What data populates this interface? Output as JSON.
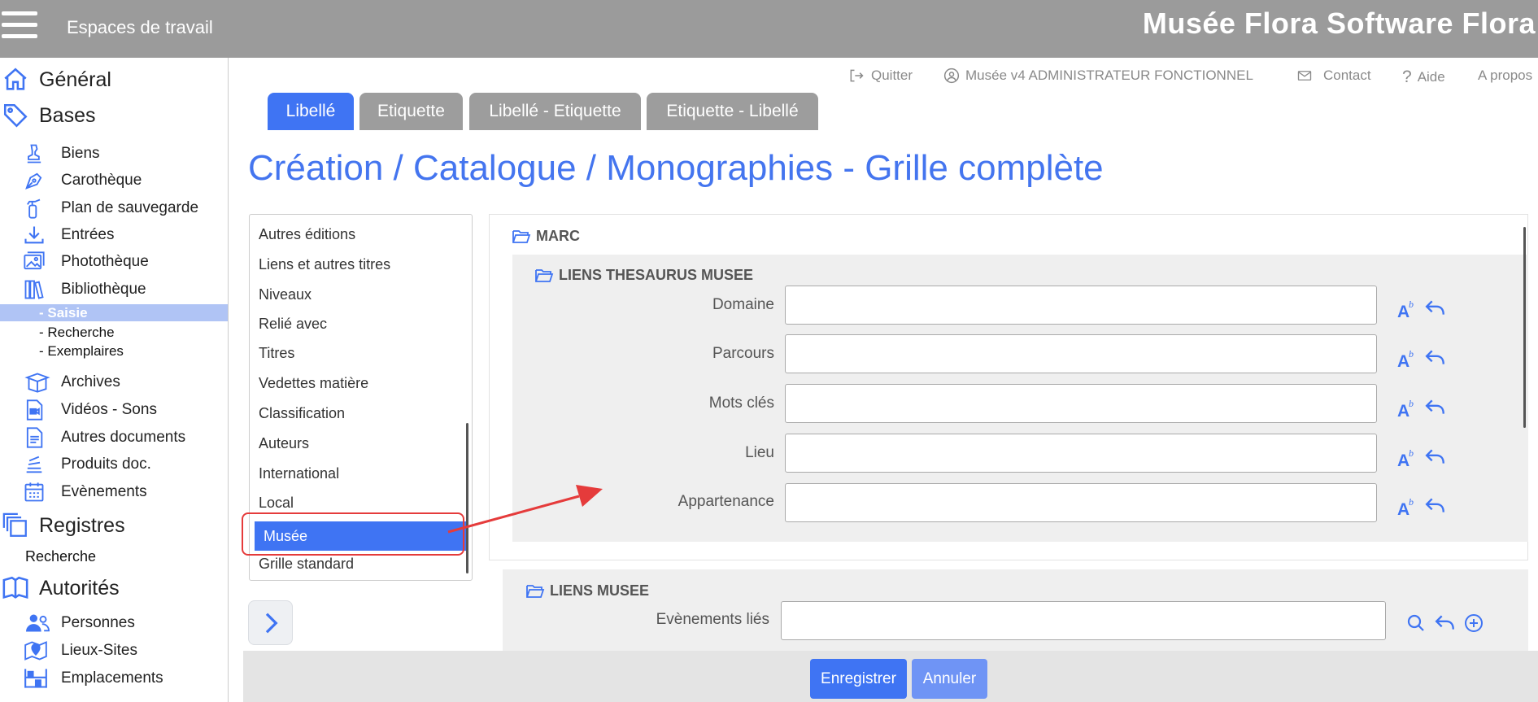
{
  "header": {
    "workspaces_label": "Espaces de travail",
    "brand": "Musée Flora Software Flora"
  },
  "sidebar": {
    "general": "Général",
    "bases": "Bases",
    "items": [
      {
        "label": "Biens",
        "icon": "bust-icon"
      },
      {
        "label": "Carothèque",
        "icon": "pen-nib-icon"
      },
      {
        "label": "Plan de sauvegarde",
        "icon": "fire-extinguisher-icon"
      },
      {
        "label": "Entrées",
        "icon": "download-icon"
      },
      {
        "label": "Photothèque",
        "icon": "images-icon"
      },
      {
        "label": "Bibliothèque",
        "icon": "books-icon"
      }
    ],
    "sub_items": [
      "- Saisie",
      "- Recherche",
      "- Exemplaires"
    ],
    "items2": [
      {
        "label": "Archives",
        "icon": "box-open-icon"
      },
      {
        "label": "Vidéos - Sons",
        "icon": "file-video-icon"
      },
      {
        "label": "Autres documents",
        "icon": "file-text-icon"
      },
      {
        "label": "Produits doc.",
        "icon": "stack-icon"
      },
      {
        "label": "Evènements",
        "icon": "calendar-icon"
      }
    ],
    "registres": "Registres",
    "recherche": "Recherche",
    "autorites": "Autorités",
    "items3": [
      {
        "label": "Personnes",
        "icon": "users-icon"
      },
      {
        "label": "Lieux-Sites",
        "icon": "map-marker-icon"
      },
      {
        "label": "Emplacements",
        "icon": "shelves-icon"
      }
    ]
  },
  "top_links": {
    "quit": "Quitter",
    "user": "Musée v4 ADMINISTRATEUR FONCTIONNEL",
    "contact": "Contact",
    "help": "Aide",
    "about": "A propos"
  },
  "tabs": [
    "Libellé",
    "Etiquette",
    "Libellé - Etiquette",
    "Etiquette - Libellé"
  ],
  "active_tab": "Libellé",
  "page_title": "Création / Catalogue / Monographies - Grille complète",
  "sections_list": [
    "Autres éditions",
    "Liens et autres titres",
    "Niveaux",
    "Relié avec",
    "Titres",
    "Vedettes matière",
    "Classification",
    "Auteurs",
    "International",
    "Local",
    "Musée",
    "Grille standard"
  ],
  "selected_section": "Musée",
  "form": {
    "marc_header": "MARC",
    "thesaurus_header": "LIENS THESAURUS MUSEE",
    "fields": [
      {
        "label": "Domaine",
        "value": ""
      },
      {
        "label": "Parcours",
        "value": ""
      },
      {
        "label": "Mots clés",
        "value": ""
      },
      {
        "label": "Lieu",
        "value": ""
      },
      {
        "label": "Appartenance",
        "value": ""
      }
    ],
    "liens_header": "LIENS MUSEE",
    "events_label": "Evènements liés",
    "events_value": ""
  },
  "buttons": {
    "save": "Enregistrer",
    "cancel": "Annuler"
  },
  "colors": {
    "accent": "#3f74f3",
    "topbar": "#9b9b9b",
    "annotation": "#e53b3b"
  }
}
